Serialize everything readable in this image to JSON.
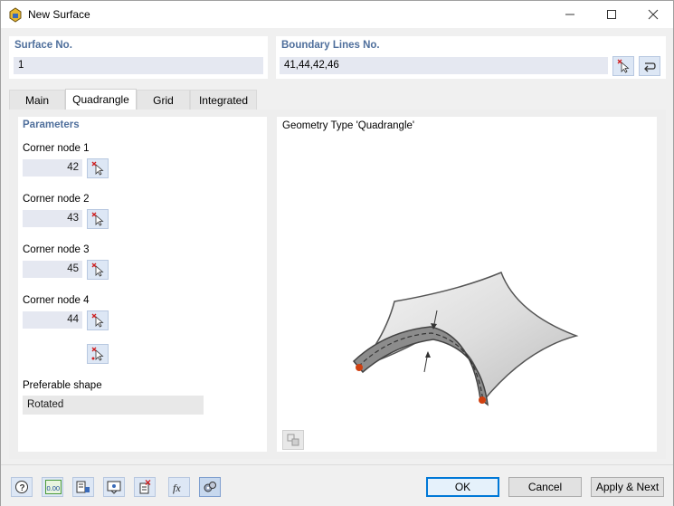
{
  "window": {
    "title": "New Surface"
  },
  "surface": {
    "label": "Surface No.",
    "value": "1"
  },
  "boundary": {
    "label": "Boundary Lines No.",
    "value": "41,44,42,46"
  },
  "tabs": [
    {
      "label": "Main"
    },
    {
      "label": "Quadrangle"
    },
    {
      "label": "Grid"
    },
    {
      "label": "Integrated"
    }
  ],
  "active_tab": "Quadrangle",
  "parameters": {
    "heading": "Parameters",
    "corners": [
      {
        "label": "Corner node 1",
        "value": "42"
      },
      {
        "label": "Corner node 2",
        "value": "43"
      },
      {
        "label": "Corner node 3",
        "value": "45"
      },
      {
        "label": "Corner node 4",
        "value": "44"
      }
    ],
    "shape_label": "Preferable shape",
    "shape_value": "Rotated"
  },
  "geometry": {
    "title": "Geometry Type 'Quadrangle'"
  },
  "buttons": {
    "ok": "OK",
    "cancel": "Cancel",
    "apply_next": "Apply & Next"
  },
  "toolbar_icons": [
    "help-icon",
    "units-icon",
    "info-panel-icon",
    "view-icon",
    "delete-item-icon",
    "formula-icon",
    "settings-icon"
  ],
  "toolbar_text": {
    "units": "0.00"
  },
  "colors": {
    "accent": "#0078d7",
    "section_label": "#4f6f9c",
    "node_marker": "#d04010"
  }
}
